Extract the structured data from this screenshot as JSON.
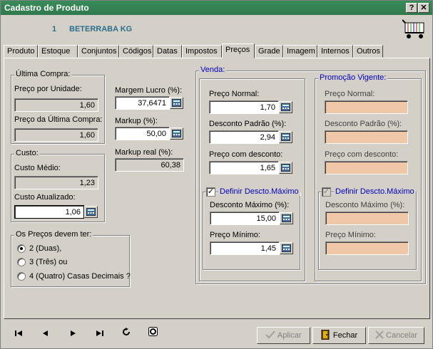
{
  "window": {
    "title": "Cadastro de Produto",
    "help_label": "?",
    "close_label": "✕"
  },
  "product": {
    "number": "1",
    "name": "BETERRABA KG"
  },
  "tabs": [
    {
      "label": "Produto"
    },
    {
      "label": "Estoque"
    },
    {
      "label": "Conjuntos"
    },
    {
      "label": "Códigos"
    },
    {
      "label": "Datas"
    },
    {
      "label": "Impostos"
    },
    {
      "label": "Preços"
    },
    {
      "label": "Grade"
    },
    {
      "label": "Imagem"
    },
    {
      "label": "Internos"
    },
    {
      "label": "Outros"
    }
  ],
  "ultima_compra": {
    "title": "Última Compra:",
    "preco_unidade_label": "Preço por Unidade:",
    "preco_unidade_value": "1,60",
    "preco_ultima_label": "Preço da Última Compra:",
    "preco_ultima_value": "1,60"
  },
  "custo": {
    "title": "Custo:",
    "medio_label": "Custo Médio:",
    "medio_value": "1,23",
    "atualizado_label": "Custo Atualizado:",
    "atualizado_value": "1,06"
  },
  "margens": {
    "margem_label": "Margem Lucro (%):",
    "margem_value": "37,6471",
    "markup_label": "Markup (%):",
    "markup_value": "50,00",
    "markup_real_label": "Markup real (%):",
    "markup_real_value": "60,38"
  },
  "decimais": {
    "title": "Os Preços devem ter:",
    "options": [
      "2 (Duas),",
      "3 (Três) ou",
      "4 (Quatro) Casas Decimais ?"
    ],
    "selected_index": 0
  },
  "venda": {
    "title": "Venda:",
    "preco_normal_label": "Preço Normal:",
    "preco_normal_value": "1,70",
    "desconto_padrao_label": "Desconto Padrão (%):",
    "desconto_padrao_value": "2,94",
    "preco_desconto_label": "Preço com desconto:",
    "preco_desconto_value": "1,65",
    "definir_label": "Definir Descto.Máximo",
    "definir_checked": true,
    "desconto_max_label": "Desconto Máximo (%):",
    "desconto_max_value": "15,00",
    "preco_minimo_label": "Preço Mínimo:",
    "preco_minimo_value": "1,45"
  },
  "promocao": {
    "title": "Promoção Vigente:",
    "preco_normal_label": "Preço Normal:",
    "desconto_padrao_label": "Desconto Padrão (%):",
    "preco_desconto_label": "Preço com desconto:",
    "definir_label": "Definir Descto.Máximo",
    "desconto_max_label": "Desconto Máximo (%):",
    "preco_minimo_label": "Preço Mínimo:",
    "field_color": "#f0c8a8"
  },
  "footer": {
    "aplicar_label": "Aplicar",
    "fechar_label": "Fechar",
    "cancelar_label": "Cancelar"
  }
}
